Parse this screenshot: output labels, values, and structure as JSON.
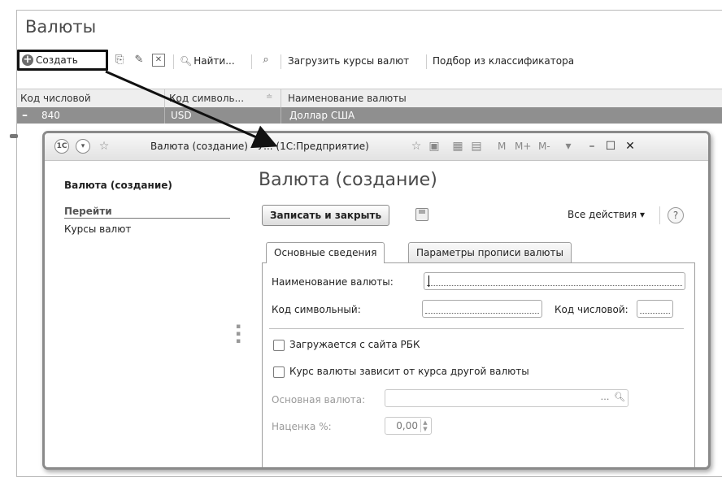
{
  "list": {
    "title": "Валюты",
    "toolbar": {
      "create": "Создать",
      "find": "Найти...",
      "load_rates": "Загрузить курсы валют",
      "classifier": "Подбор из классификатора"
    },
    "columns": [
      "Код числовой",
      "Код символь...",
      "Наименование валюты"
    ],
    "rows": [
      {
        "code_num": "840",
        "code_sym": "USD",
        "name": "Доллар США"
      }
    ]
  },
  "dialog": {
    "window_title": "Валюта (создание) - У... (1С:Предприятие)",
    "title_icons": [
      "1c-logo-icon",
      "menu-icon",
      "star-icon",
      "star-icon",
      "history-icon",
      "calc-icon",
      "calendar-icon"
    ],
    "memory": {
      "m": "M",
      "m_plus": "M+",
      "m_minus": "M-"
    },
    "sidebar": {
      "title": "Валюта (создание)",
      "group": "Перейти",
      "links": [
        "Курсы валют"
      ]
    },
    "form": {
      "title": "Валюта (создание)",
      "save_close": "Записать и закрыть",
      "all_actions": "Все действия ▾",
      "help": "?",
      "tabs": [
        "Основные сведения",
        "Параметры прописи валюты"
      ],
      "fields": {
        "name_label": "Наименование валюты:",
        "name_value": "",
        "symbol_label": "Код символьный:",
        "symbol_value": "",
        "numeric_label": "Код числовой:",
        "numeric_value": "",
        "checkbox_rbk": "Загружается с сайта РБК",
        "checkbox_rbk_checked": false,
        "checkbox_depends": "Курс валюты зависит от курса другой валюты",
        "checkbox_depends_checked": false,
        "base_currency_label": "Основная валюта:",
        "base_currency_value": "",
        "markup_label": "Наценка %:",
        "markup_value": "0,00"
      }
    }
  }
}
